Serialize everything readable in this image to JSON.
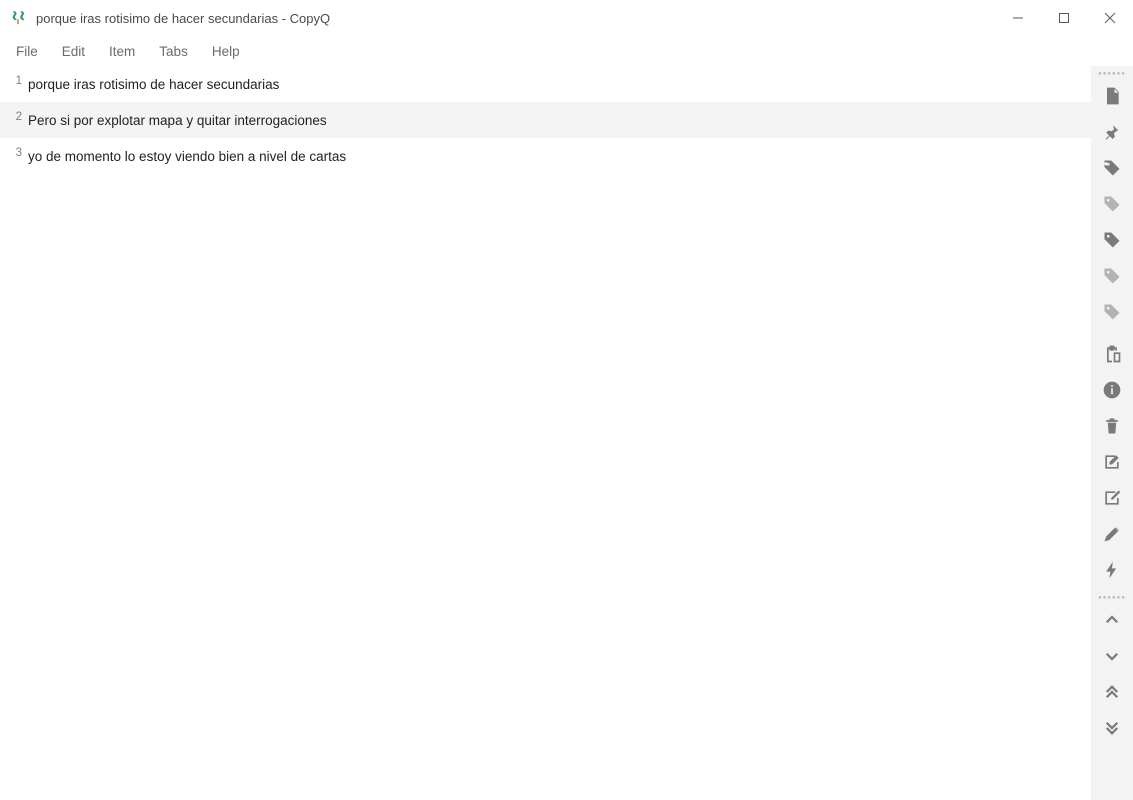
{
  "window": {
    "title": "porque iras rotisimo de hacer secundarias - CopyQ"
  },
  "menu": {
    "file": "File",
    "edit": "Edit",
    "item": "Item",
    "tabs": "Tabs",
    "help": "Help"
  },
  "clips": [
    {
      "index": "1",
      "text": "porque iras rotisimo de hacer secundarias"
    },
    {
      "index": "2",
      "text": "Pero si por explotar mapa y quitar interrogaciones"
    },
    {
      "index": "3",
      "text": "yo de momento lo estoy viendo bien a nivel de cartas"
    }
  ],
  "toolbar": {
    "note": "New note",
    "pin": "Pin",
    "tag1": "Tag",
    "tag2": "Tag",
    "tag3": "Tag",
    "tag4": "Tag",
    "tag5": "Tag",
    "paste": "Paste",
    "info": "Info",
    "delete": "Delete",
    "edit1": "Edit",
    "edit2": "Edit external",
    "editpen": "Edit content",
    "action": "Run action",
    "up": "Move up",
    "down": "Move down",
    "top": "Move to top",
    "bottom": "Move to bottom"
  },
  "icons": {
    "note_name": "note-icon",
    "pin_name": "pin-icon",
    "tag_name": "tag-icon",
    "paste_name": "clipboard-icon",
    "info_name": "info-icon",
    "trash_name": "trash-icon",
    "edit_name": "edit-square-icon",
    "pencil_name": "pencil-icon",
    "bolt_name": "bolt-icon",
    "chev_up_name": "chevron-up-icon",
    "chev_down_name": "chevron-down-icon",
    "dchev_up_name": "double-chevron-up-icon",
    "dchev_down_name": "double-chevron-down-icon",
    "minimize_name": "minimize-icon",
    "maximize_name": "maximize-icon",
    "close_name": "close-icon",
    "app_logo_name": "app-logo-icon"
  }
}
